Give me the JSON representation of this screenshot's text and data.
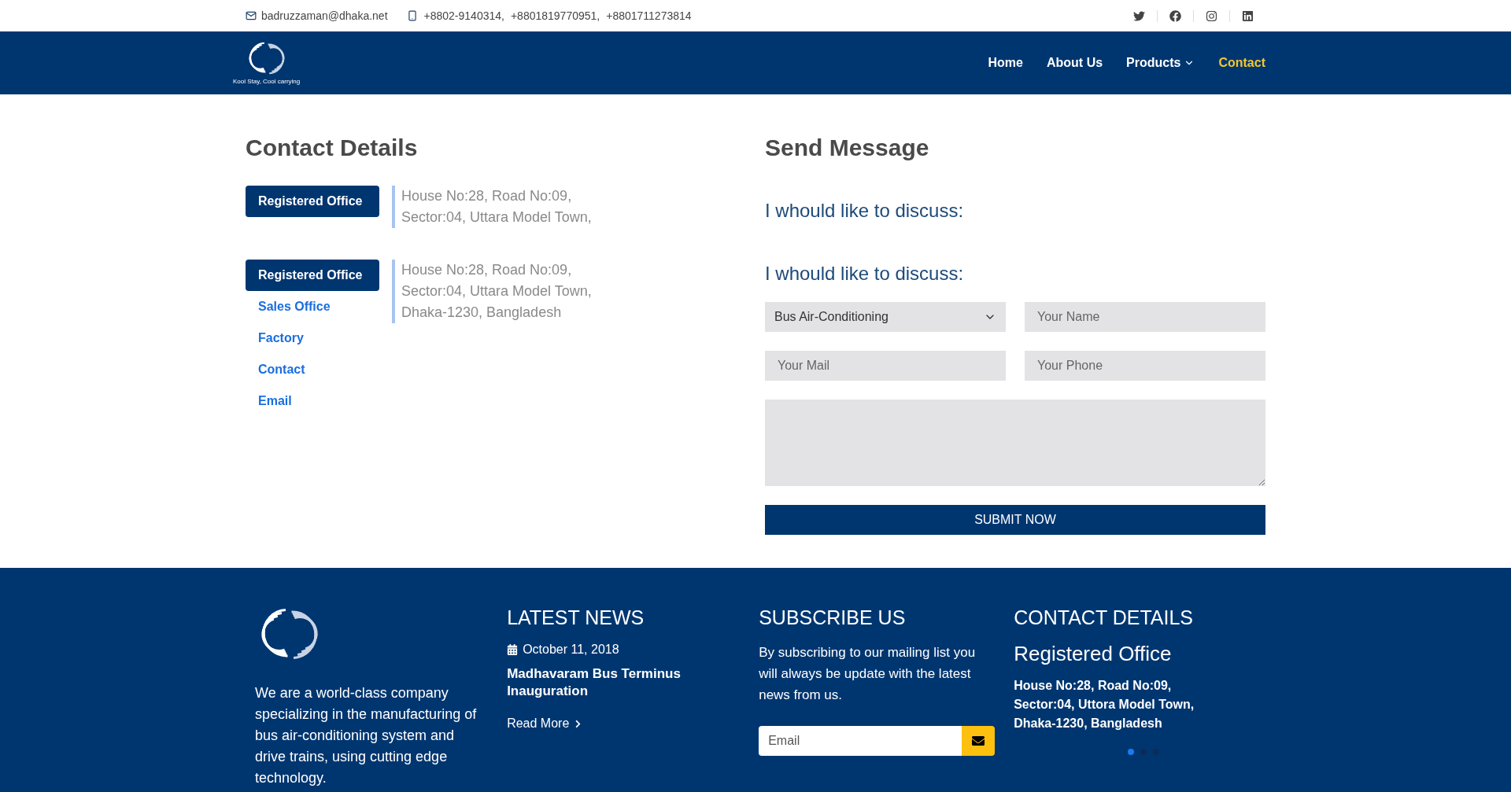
{
  "top_bar": {
    "email": "badruzzaman@dhaka.net",
    "phones": [
      "+8802-9140314,",
      "+8801819770951,",
      "+8801711273814"
    ],
    "social": [
      {
        "kind": "twitter"
      },
      {
        "kind": "facebook"
      },
      {
        "kind": "instagram"
      },
      {
        "kind": "linkedin"
      }
    ]
  },
  "nav": {
    "logo_tagline": "Kool Stay, Cool carrying",
    "items": [
      {
        "label": "Home",
        "selected": false,
        "dropdown": false
      },
      {
        "label": "About Us",
        "selected": false,
        "dropdown": false
      },
      {
        "label": "Products",
        "selected": false,
        "dropdown": true
      },
      {
        "label": "Contact",
        "selected": true,
        "dropdown": false
      }
    ]
  },
  "contact_details": {
    "title": "Contact Details",
    "blocks": [
      {
        "tabs": [
          {
            "label": "Registered Office",
            "selected": true
          }
        ],
        "address_lines": [
          "House No:28, Road No:09,",
          "Sector:04, Uttara Model Town,"
        ]
      },
      {
        "tabs": [
          {
            "label": "Registered Office",
            "selected": true
          },
          {
            "label": "Sales Office",
            "selected": false
          },
          {
            "label": "Factory",
            "selected": false
          },
          {
            "label": "Contact",
            "selected": false
          },
          {
            "label": "Email",
            "selected": false
          }
        ],
        "address_lines": [
          "House No:28, Road No:09,",
          "Sector:04, Uttara Model Town,",
          "Dhaka-1230, Bangladesh"
        ]
      }
    ]
  },
  "send_message": {
    "title": "Send Message",
    "subtitles": [
      "I whould like to discuss:",
      "I whould like to discuss:"
    ],
    "topic_select": {
      "value": "Bus Air-Conditioning"
    },
    "name_field": {
      "placeholder": "Your Name"
    },
    "mail_field": {
      "placeholder": "Your Mail"
    },
    "phone_field": {
      "placeholder": "Your Phone"
    },
    "submit": "SUBMIT NOW"
  },
  "footer": {
    "about": "We are a world-class company specializing in the manufacturing of bus air-conditioning system and drive trains, using cutting edge technology.",
    "news": {
      "title": "LATEST NEWS",
      "date": "October 11, 2018",
      "headline": "Madhavaram Bus Terminus Inauguration",
      "read_more": "Read More"
    },
    "subscribe": {
      "title": "SUBSCRIBE US",
      "text": "By subscribing to our mailing list you will always be update with the latest news from us.",
      "email_field": {
        "placeholder": "Email"
      }
    },
    "contact": {
      "title": "CONTACT DETAILS",
      "office": "Registered Office",
      "address_lines": [
        "House No:28, Road No:09,",
        "Sector:04, Uttora Model Town,",
        "Dhaka-1230, Bangladesh"
      ],
      "dots": [
        {
          "selected": true
        },
        {
          "selected": false
        },
        {
          "selected": false
        }
      ]
    }
  }
}
